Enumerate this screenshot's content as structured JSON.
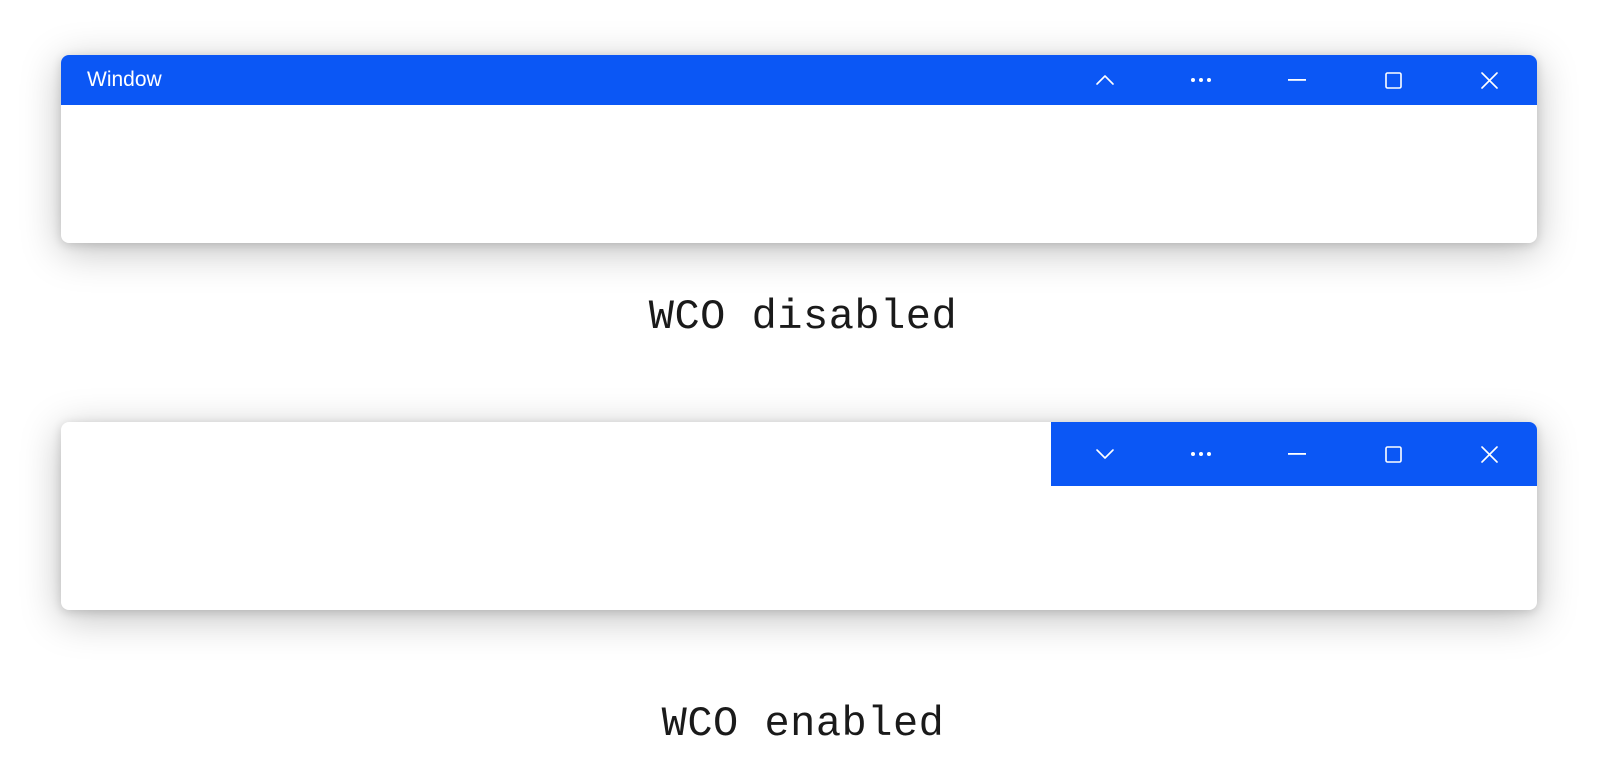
{
  "window_disabled": {
    "title": "Window",
    "controls": {
      "chevron": "chevron-up",
      "more": "more",
      "minimize": "minimize",
      "maximize": "maximize",
      "close": "close"
    }
  },
  "window_enabled": {
    "controls": {
      "chevron": "chevron-down",
      "more": "more",
      "minimize": "minimize",
      "maximize": "maximize",
      "close": "close"
    }
  },
  "captions": {
    "disabled": "WCO disabled",
    "enabled": "WCO enabled"
  },
  "colors": {
    "accent": "#0b57f5",
    "icon": "#ffffff"
  }
}
